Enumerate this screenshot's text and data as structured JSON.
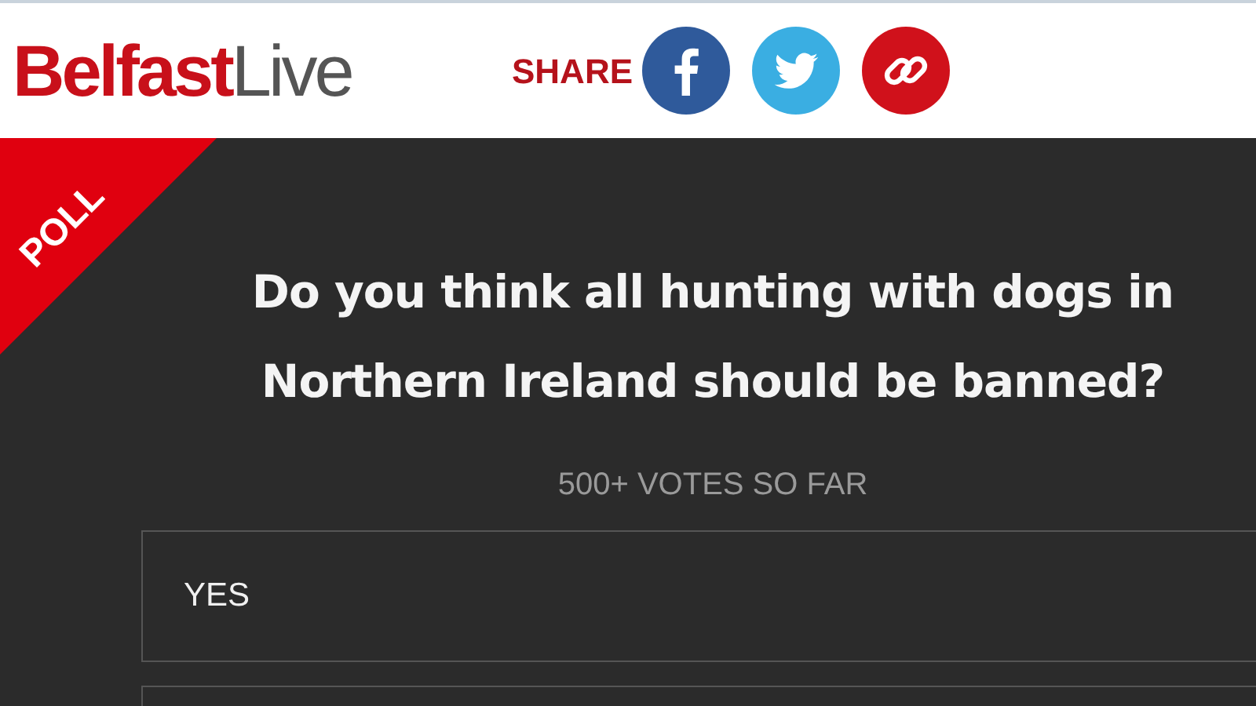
{
  "header": {
    "logo": {
      "primary": "Belfast",
      "secondary": "Live"
    },
    "share_label": "SHARE",
    "share_buttons": [
      {
        "kind": "facebook"
      },
      {
        "kind": "twitter"
      },
      {
        "kind": "link"
      }
    ]
  },
  "poll": {
    "badge": "POLL",
    "question": "Do you think all hunting with dogs in Northern Ireland should be banned?",
    "votes": "500+ VOTES SO FAR",
    "options": [
      {
        "label": "YES"
      }
    ]
  }
}
